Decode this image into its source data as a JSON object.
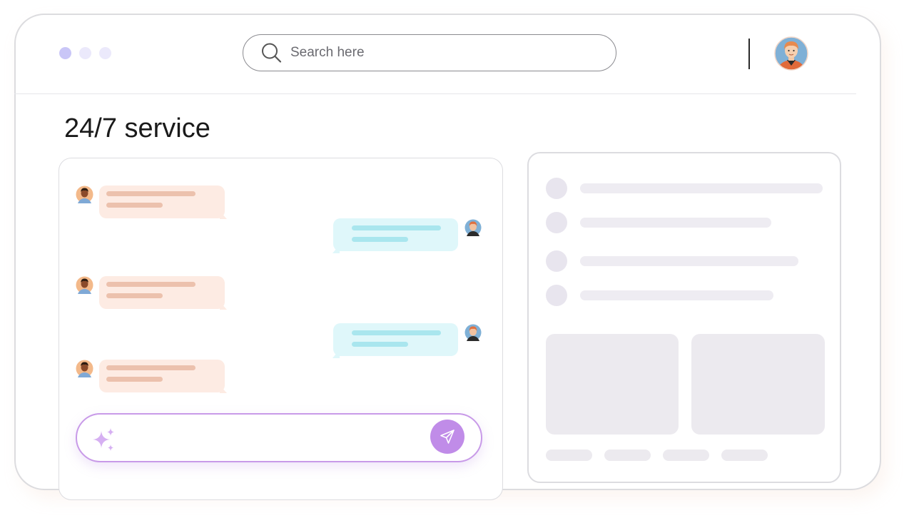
{
  "header": {
    "search_placeholder": "Search here",
    "window_dots": [
      "#c9c6f7",
      "#ebe9fb",
      "#ebe9fb"
    ]
  },
  "page": {
    "title": "24/7 service"
  },
  "chat": {
    "messages": [
      {
        "from": "agent",
        "avatar": "agent-avatar-icon"
      },
      {
        "from": "user",
        "avatar": "user-avatar-icon"
      },
      {
        "from": "agent",
        "avatar": "agent-avatar-icon"
      },
      {
        "from": "user",
        "avatar": "user-avatar-icon"
      },
      {
        "from": "agent",
        "avatar": "agent-avatar-icon"
      }
    ],
    "composer": {
      "placeholder": "",
      "icon": "sparkle-icon",
      "send_icon": "send-icon"
    }
  },
  "colors": {
    "accent": "#c08ce8",
    "incoming_bubble": "#fdebe3",
    "outgoing_bubble": "#dff7fa",
    "skeleton": "#eceaef"
  }
}
